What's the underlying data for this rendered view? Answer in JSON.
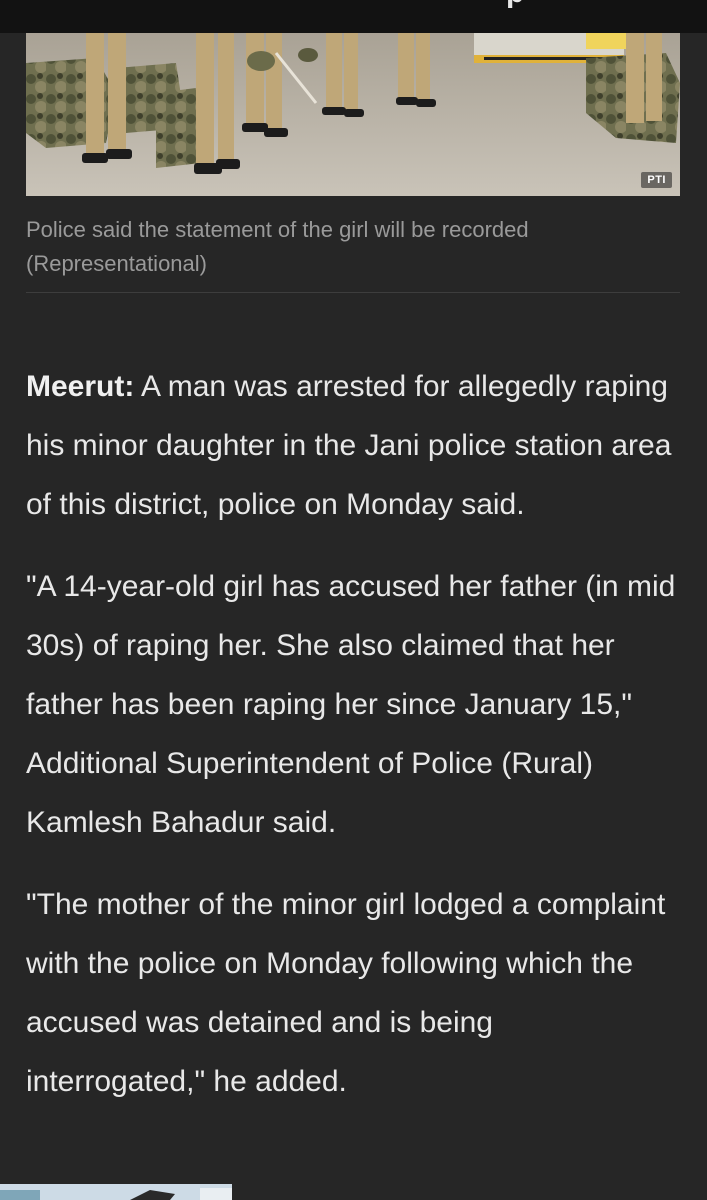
{
  "top_bar": {
    "glyph": "p"
  },
  "photo": {
    "subject": "police-personnel-photo",
    "credit": "PTI"
  },
  "caption": {
    "text": "Police said the statement of the girl will be recorded (Representational)"
  },
  "article": {
    "dateline": "Meerut:",
    "lead": " A man was arrested for allegedly raping his minor daughter in the Jani police station area of this district, police on Monday said.",
    "paragraphs": [
      "\"A 14-year-old girl has accused her father (in mid 30s) of raping her. She also claimed that her father has been raping her since January 15,\" Additional Superintendent of Police (Rural) Kamlesh Bahadur said.",
      "\"The mother of the minor girl lodged a complaint with the police on Monday following which the accused was detained and is being interrogated,\" he added."
    ]
  },
  "colors": {
    "background": "#262626",
    "top_bar": "#121212",
    "body_text": "#e8e8e8",
    "caption_text": "#9a9a9a"
  }
}
